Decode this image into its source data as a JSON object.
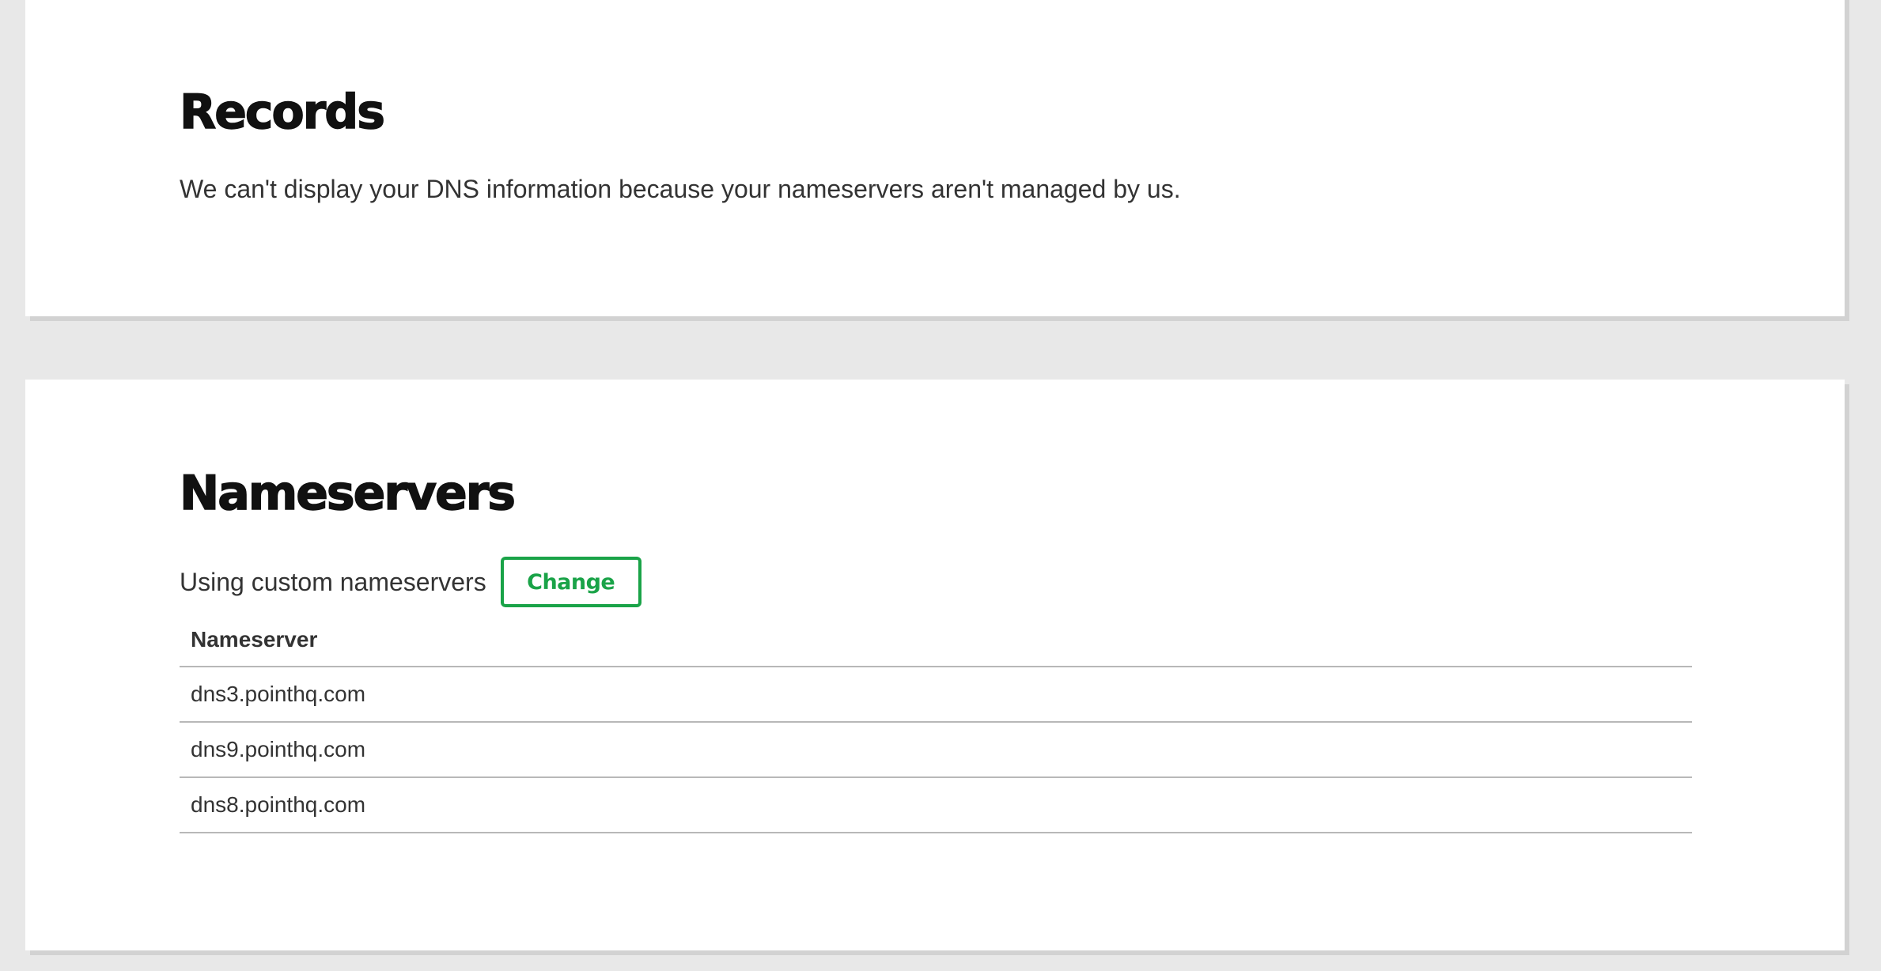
{
  "records": {
    "title": "Records",
    "message": "We can't display your DNS information because your nameservers aren't managed by us."
  },
  "nameservers": {
    "title": "Nameservers",
    "status": "Using custom nameservers",
    "change_label": "Change",
    "table_header": "Nameserver",
    "rows": [
      "dns3.pointhq.com",
      "dns9.pointhq.com",
      "dns8.pointhq.com"
    ]
  },
  "colors": {
    "accent": "#1aa348",
    "page_background": "#e8e8e8",
    "card_background": "#ffffff"
  }
}
